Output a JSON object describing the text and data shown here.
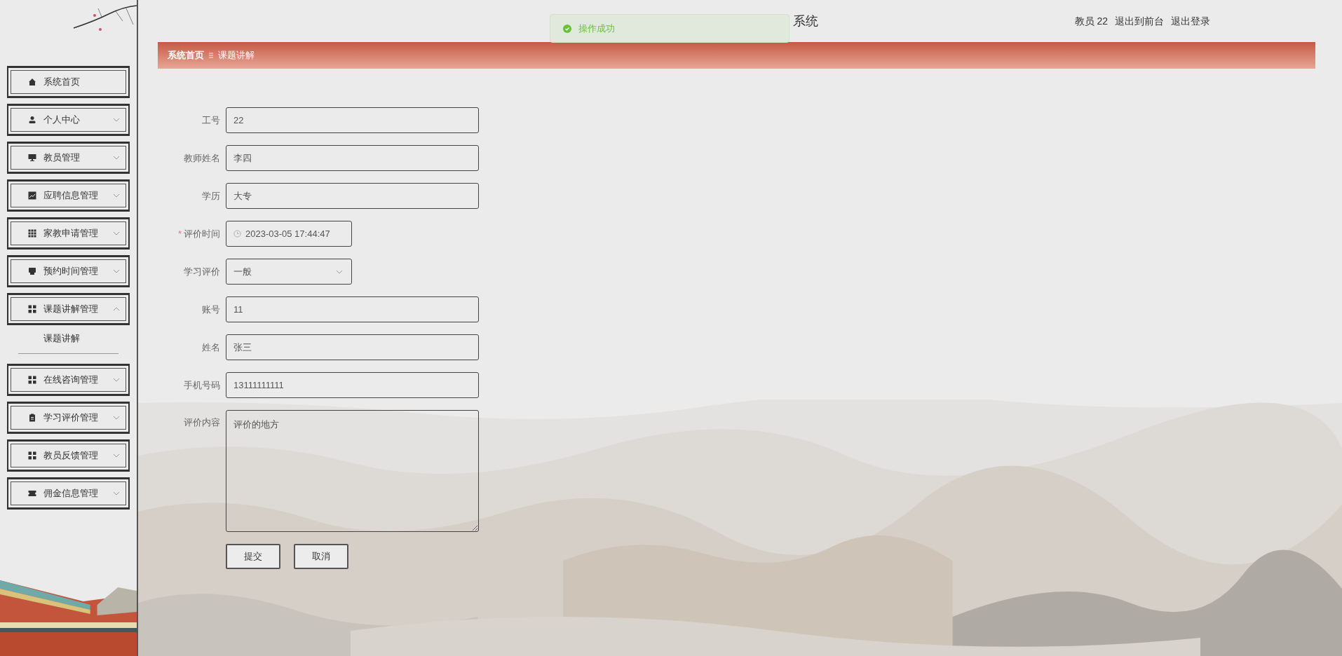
{
  "sidebar": {
    "items": [
      {
        "label": "系统首页",
        "kind": "home"
      },
      {
        "label": "个人中心",
        "kind": "user",
        "expanded": false
      },
      {
        "label": "教员管理",
        "kind": "monitor",
        "expanded": false
      },
      {
        "label": "应聘信息管理",
        "kind": "chart",
        "expanded": false
      },
      {
        "label": "家教申请管理",
        "kind": "grid9",
        "expanded": false
      },
      {
        "label": "预约时间管理",
        "kind": "printer",
        "expanded": false
      },
      {
        "label": "课题讲解管理",
        "kind": "grid4",
        "expanded": true,
        "children": [
          {
            "label": "课题讲解"
          }
        ]
      },
      {
        "label": "在线咨询管理",
        "kind": "grid4",
        "expanded": false
      },
      {
        "label": "学习评价管理",
        "kind": "clipboard",
        "expanded": false
      },
      {
        "label": "教员反馈管理",
        "kind": "grid4",
        "expanded": false
      },
      {
        "label": "佣金信息管理",
        "kind": "ticket",
        "expanded": false
      }
    ]
  },
  "header": {
    "title": "系统",
    "user": "教员 22",
    "links": [
      "退出到前台",
      "退出登录"
    ]
  },
  "toast": {
    "message": "操作成功"
  },
  "breadcrumb": [
    "系统首页",
    "课题讲解"
  ],
  "form": {
    "fields": [
      {
        "label": "工号",
        "kind": "text",
        "value": "22"
      },
      {
        "label": "教师姓名",
        "kind": "text",
        "value": "李四"
      },
      {
        "label": "学历",
        "kind": "text",
        "value": "大专"
      },
      {
        "label": "评价时间",
        "kind": "datetime",
        "value": "2023-03-05 17:44:47",
        "marker": "*"
      },
      {
        "label": "学习评价",
        "kind": "select",
        "value": "一般"
      },
      {
        "label": "账号",
        "kind": "text",
        "value": "11"
      },
      {
        "label": "姓名",
        "kind": "text",
        "value": "张三"
      },
      {
        "label": "手机号码",
        "kind": "text",
        "value": "13111111111"
      },
      {
        "label": "评价内容",
        "kind": "textarea",
        "value": "评价的地方"
      }
    ],
    "buttons": [
      "提交",
      "取消"
    ]
  }
}
